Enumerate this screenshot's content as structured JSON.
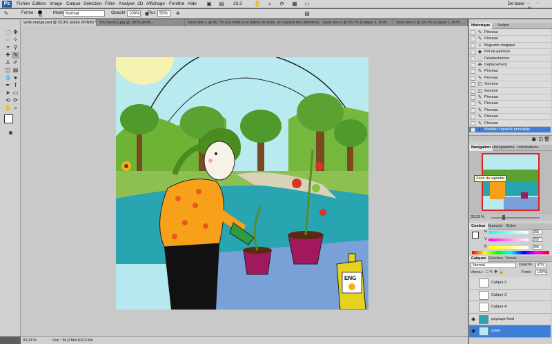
{
  "menubar": {
    "logo": "Ps",
    "items": [
      "Fichier",
      "Edition",
      "Image",
      "Calque",
      "Sélection",
      "Filtre",
      "Analyse",
      "3D",
      "Affichage",
      "Fenêtre",
      "Aide"
    ],
    "zoom_value": "33,3",
    "workspace": "De base",
    "window_controls": "– ▫ ✕"
  },
  "options": {
    "brush_label": "Forme :",
    "brush_size": "70",
    "mode_label": "Mode :",
    "mode_value": "Normal",
    "opacity_label": "Opacité :",
    "opacity_value": "100%",
    "flow_label": "Flux :",
    "flow_value": "50%"
  },
  "tabs": [
    {
      "label": "verts.orange.psd @ 33,3% (soleil, RVB/8) *",
      "active": true
    },
    {
      "label": "Tournesol 1.jpg @ 100% (RVB...",
      "active": false
    },
    {
      "label": "Sans titre-1 @ 66,7% (Un reflet à un thème de fond : en copiant des éléments...",
      "active": false
    },
    {
      "label": "Sans titre-2 @ 66,7% (Calque 1, RVB...",
      "active": false
    },
    {
      "label": "Sans titre-3 @ 66,7% (Calque 1, RVB...",
      "active": false
    }
  ],
  "history": {
    "tabs": [
      "Historique",
      "Scripts"
    ],
    "rows": [
      {
        "icon": "brush-icon",
        "label": "Pinceau",
        "selected": false
      },
      {
        "icon": "brush-icon",
        "label": "Pinceau",
        "selected": false
      },
      {
        "icon": "magic-wand-icon",
        "label": "Baguette magique",
        "selected": false
      },
      {
        "icon": "paint-bucket-icon",
        "label": "Pot de peinture",
        "selected": false
      },
      {
        "icon": "deselect-icon",
        "label": "Désélectionner",
        "selected": false
      },
      {
        "icon": "move-icon",
        "label": "Déplacement",
        "selected": false
      },
      {
        "icon": "brush-icon",
        "label": "Pinceau",
        "selected": false
      },
      {
        "icon": "brush-icon",
        "label": "Pinceau",
        "selected": false
      },
      {
        "icon": "eraser-icon",
        "label": "Gomme",
        "selected": false
      },
      {
        "icon": "eraser-icon",
        "label": "Gomme",
        "selected": false
      },
      {
        "icon": "brush-icon",
        "label": "Pinceau",
        "selected": false
      },
      {
        "icon": "brush-icon",
        "label": "Pinceau",
        "selected": false
      },
      {
        "icon": "brush-icon",
        "label": "Pinceau",
        "selected": false
      },
      {
        "icon": "brush-icon",
        "label": "Pinceau",
        "selected": false
      },
      {
        "icon": "brush-icon",
        "label": "Pinceau",
        "selected": false
      },
      {
        "icon": "opacity-icon",
        "label": "Modifier l'opacité principale",
        "selected": true
      }
    ]
  },
  "navigator": {
    "tabs": [
      "Navigation",
      "Histogramme",
      "Informations"
    ],
    "tooltip": "Zone de vignette",
    "zoom": "33,33 %"
  },
  "color": {
    "tabs": [
      "Couleur",
      "Nuancier",
      "Styles"
    ],
    "channels": [
      {
        "label": "R",
        "value": "255"
      },
      {
        "label": "V",
        "value": "255"
      },
      {
        "label": "B",
        "value": "255"
      }
    ]
  },
  "layers": {
    "tabs": [
      "Calques",
      "Couches",
      "Tracés"
    ],
    "blend_mode": "Normal",
    "opacity_label": "Opacité :",
    "opacity_value": "47%",
    "lock_label": "Verrou :",
    "fill_label": "Fond :",
    "fill_value": "100%",
    "rows": [
      {
        "label": "Calque 2",
        "visible": false,
        "selected": false
      },
      {
        "label": "Calque 3",
        "visible": false,
        "selected": false
      },
      {
        "label": "Calque 4",
        "visible": false,
        "selected": false
      },
      {
        "label": "paysage fond",
        "visible": true,
        "selected": false
      },
      {
        "label": "soleil",
        "visible": true,
        "selected": true
      }
    ]
  },
  "status": {
    "zoom": "33,33 %",
    "doc": "Doc : 36,0 Mo/102,5 Mo"
  },
  "artwork": {
    "bottle_label": "ENG"
  },
  "colors": {
    "accent": "#3d7fd6",
    "sky": "#b6e8ef",
    "grass": "#8cc152",
    "water": "#28a5b1",
    "table": "#7aa0d8",
    "shirt": "#f7a11a",
    "pot": "#a1195c"
  }
}
